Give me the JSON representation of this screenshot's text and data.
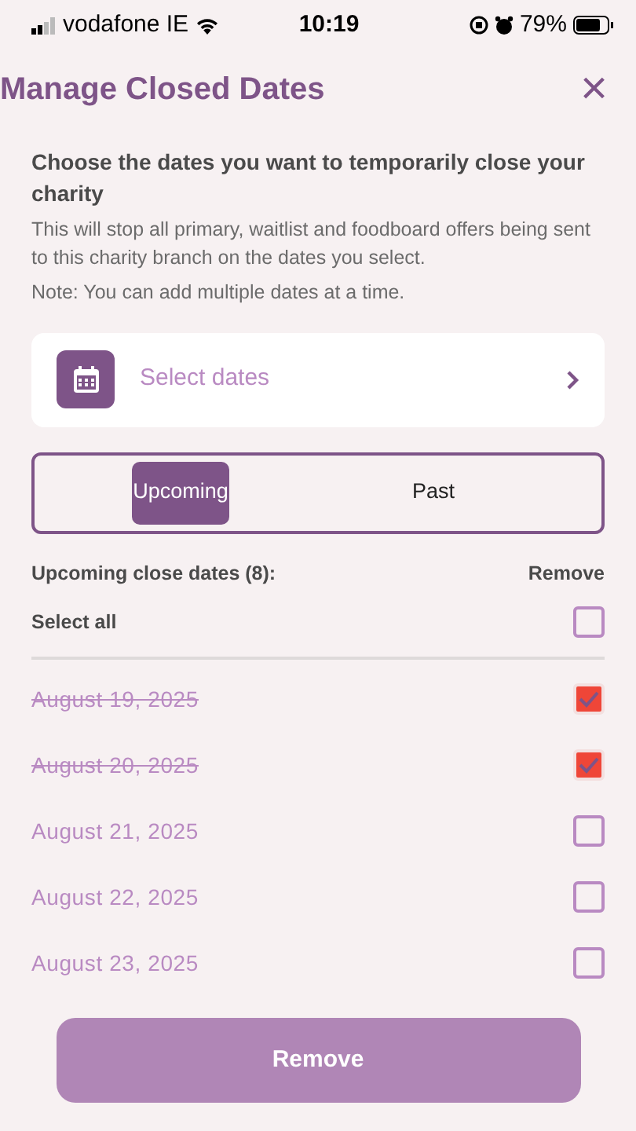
{
  "status_bar": {
    "carrier": "vodafone IE",
    "time": "10:19",
    "battery": "79%"
  },
  "header": {
    "title": "Manage Closed Dates",
    "close": "×"
  },
  "intro": {
    "heading": "Choose the dates you want to temporarily close your charity",
    "description": "This will stop all primary, waitlist and foodboard offers being sent to this charity branch on the dates you select.",
    "note": "Note: You can add multiple dates at a time."
  },
  "date_picker": {
    "label": "Select dates"
  },
  "tabs": [
    {
      "label": "Upcoming",
      "selected": true
    },
    {
      "label": "Past",
      "selected": false
    }
  ],
  "list_header": {
    "title": "Upcoming close dates (8):",
    "action": "Remove"
  },
  "select_all": {
    "label": "Select all",
    "checked": false
  },
  "dates": [
    {
      "label": "August 19, 2025",
      "checked": true
    },
    {
      "label": "August 20, 2025",
      "checked": true
    },
    {
      "label": "August 21, 2025",
      "checked": false
    },
    {
      "label": "August 22, 2025",
      "checked": false
    },
    {
      "label": "August 23, 2025",
      "checked": false
    }
  ],
  "remove_button": {
    "label": "Remove"
  }
}
